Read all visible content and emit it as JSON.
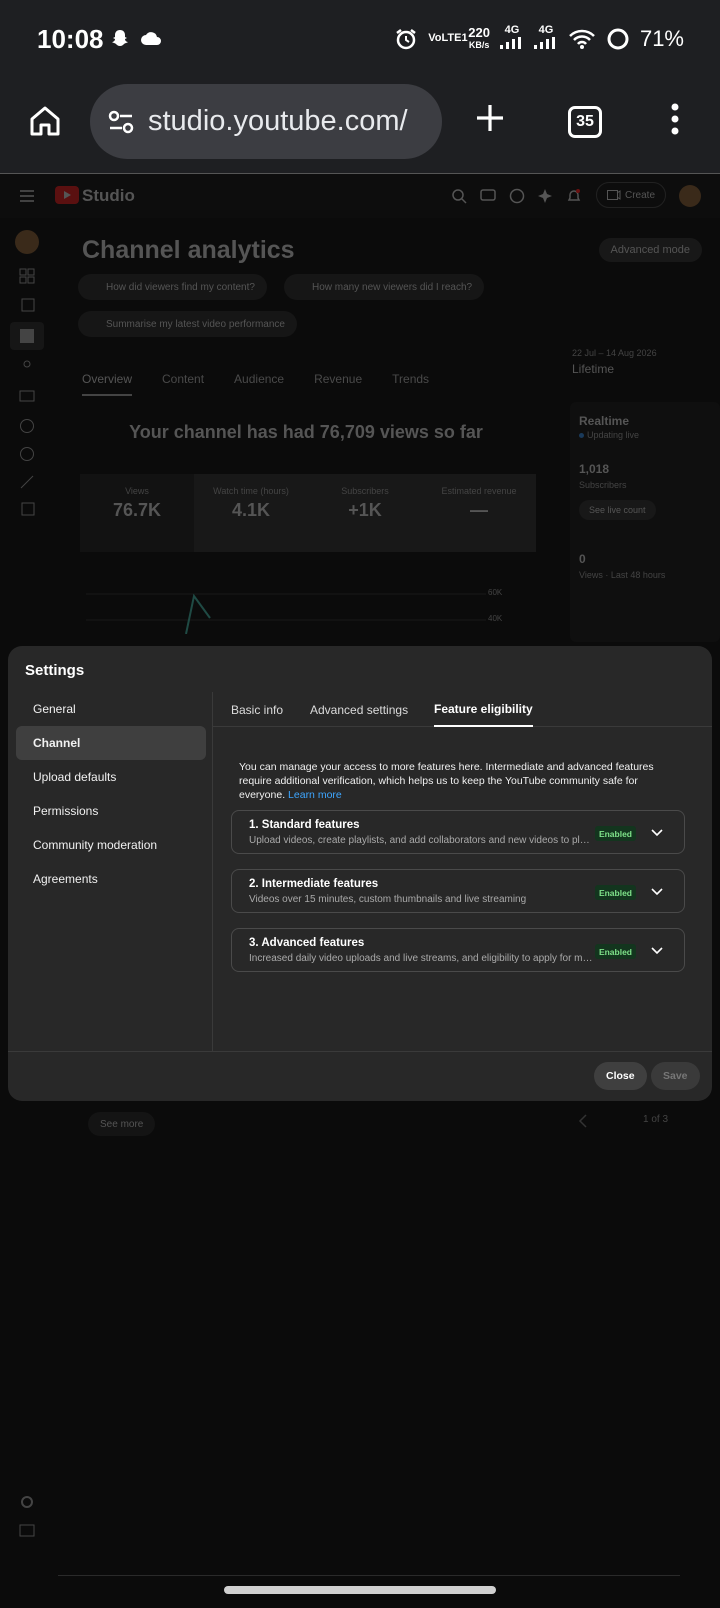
{
  "status_bar": {
    "time": "10:08",
    "net_speed_value": "220",
    "net_speed_unit": "KB/s",
    "volte_label": "VoLTE1",
    "signal1": "4G",
    "signal2": "4G",
    "battery": "71%"
  },
  "browser": {
    "url": "studio.youtube.com/",
    "tab_count": "35"
  },
  "studio": {
    "brand": "Studio",
    "create_label": "Create",
    "page_title": "Channel analytics",
    "advanced_mode": "Advanced mode",
    "chips": [
      "How did viewers find my content?",
      "How many new viewers did I reach?",
      "Summarise my latest video performance"
    ],
    "tabs": [
      "Overview",
      "Content",
      "Audience",
      "Revenue",
      "Trends"
    ],
    "date_range": "22 Jul – 14 Aug 2026",
    "period": "Lifetime",
    "views_message": "Your channel has had 76,709 views so far",
    "metrics": [
      {
        "label": "Views",
        "value": "76.7K"
      },
      {
        "label": "Watch time (hours)",
        "value": "4.1K"
      },
      {
        "label": "Subscribers",
        "value": "+1K"
      },
      {
        "label": "Estimated revenue",
        "value": "—"
      }
    ],
    "chart_ticks": [
      "60K",
      "40K"
    ],
    "realtime": {
      "title": "Realtime",
      "status": "Updating live",
      "subs_value": "1,018",
      "subs_label": "Subscribers",
      "live_count_button": "See live count",
      "views_value": "0",
      "views_label": "Views · Last 48 hours"
    },
    "see_more": "See more",
    "pager": "1 of 3"
  },
  "settings": {
    "title": "Settings",
    "nav": [
      "General",
      "Channel",
      "Upload defaults",
      "Permissions",
      "Community moderation",
      "Agreements"
    ],
    "tabs": [
      "Basic info",
      "Advanced settings",
      "Feature eligibility"
    ],
    "intro": "You can manage your access to more features here. Intermediate and advanced features require additional verification, which helps us to keep the YouTube community safe for everyone.",
    "learn_more": "Learn more",
    "features": [
      {
        "title": "1. Standard features",
        "desc": "Upload videos, create playlists, and add collaborators and new videos to playlists",
        "status": "Enabled"
      },
      {
        "title": "2. Intermediate features",
        "desc": "Videos over 15 minutes, custom thumbnails and live streaming",
        "status": "Enabled"
      },
      {
        "title": "3. Advanced features",
        "desc": "Increased daily video uploads and live streams, and eligibility to apply for monetisation",
        "status": "Enabled"
      }
    ],
    "close": "Close",
    "save": "Save"
  },
  "colors": {
    "accent_link": "#3ea6ff",
    "enabled_bg": "#13351e",
    "enabled_text": "#7fe28a",
    "brand_red": "#ff0000"
  }
}
